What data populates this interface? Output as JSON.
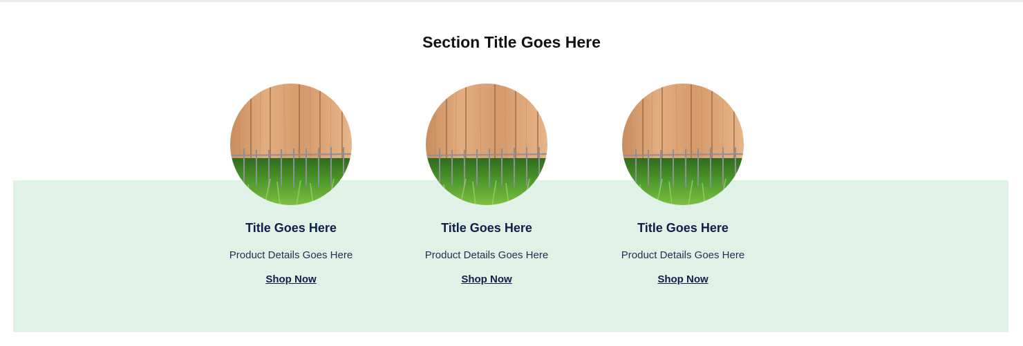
{
  "section": {
    "title": "Section Title Goes Here"
  },
  "colors": {
    "band_background": "#e0f1e6",
    "title_navy": "#0e1f4d",
    "wood": "#d9a274",
    "grass": "#4f9a2e"
  },
  "cards": [
    {
      "image": "fence-grass-photo",
      "title": "Title Goes Here",
      "details": "Product Details Goes Here",
      "link": "Shop Now"
    },
    {
      "image": "fence-grass-photo",
      "title": "Title Goes Here",
      "details": "Product Details Goes Here",
      "link": "Shop Now"
    },
    {
      "image": "fence-grass-photo",
      "title": "Title Goes Here",
      "details": "Product Details Goes Here",
      "link": "Shop Now"
    }
  ]
}
